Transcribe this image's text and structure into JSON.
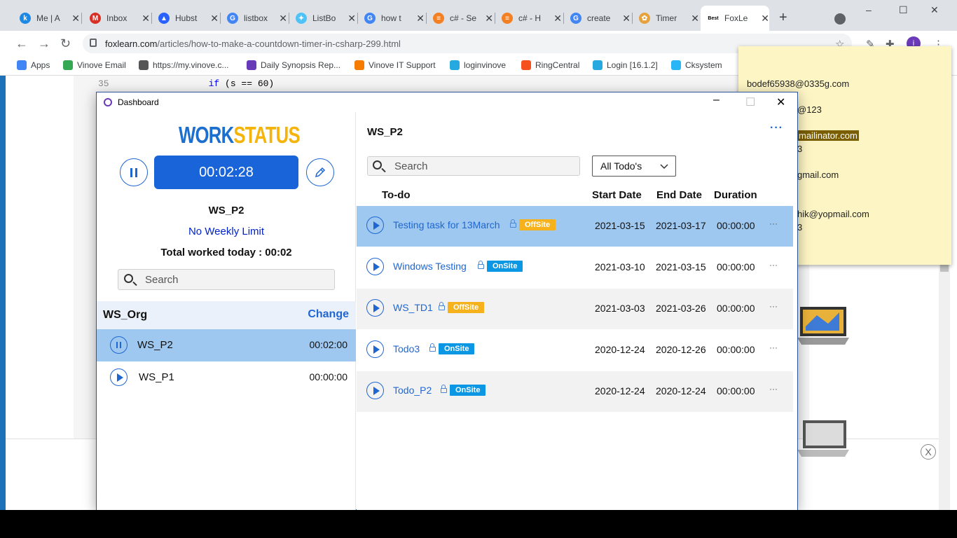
{
  "browser": {
    "tabs": [
      {
        "title": "Me | A",
        "color": "#1e88e5",
        "letter": "k"
      },
      {
        "title": "Inbox",
        "color": "#d93025",
        "letter": "M"
      },
      {
        "title": "Hubst",
        "color": "#2962ff",
        "letter": "▲"
      },
      {
        "title": "listbox",
        "color": "#4285f4",
        "letter": "G"
      },
      {
        "title": "ListBo",
        "color": "#4fc3f7",
        "letter": "✦"
      },
      {
        "title": "how t",
        "color": "#4285f4",
        "letter": "G"
      },
      {
        "title": "c# - Se",
        "color": "#f48024",
        "letter": "≡"
      },
      {
        "title": "c# - H",
        "color": "#f48024",
        "letter": "≡"
      },
      {
        "title": "create",
        "color": "#4285f4",
        "letter": "G"
      },
      {
        "title": "Timer",
        "color": "#e6a23c",
        "letter": "✿"
      },
      {
        "title": "FoxLe",
        "color": "#ffffff",
        "letter": "Best"
      }
    ],
    "new_tab": "+",
    "window_controls": [
      "–",
      "☐",
      "✕"
    ],
    "url": {
      "domain": "foxlearn.com",
      "path": "/articles/how-to-make-a-countdown-timer-in-csharp-299.html"
    },
    "profile_letter": "i",
    "bookmarks": [
      {
        "label": "Apps",
        "color": "#4285f4"
      },
      {
        "label": "Vinove Email",
        "color": "#34a853"
      },
      {
        "label": "https://my.vinove.c...",
        "color": "#555555"
      },
      {
        "label": "Daily Synopsis Rep...",
        "color": "#673ab7"
      },
      {
        "label": "Vinove IT Support",
        "color": "#f57c00"
      },
      {
        "label": "loginvinove",
        "color": "#26a9e0"
      },
      {
        "label": "RingCentral",
        "color": "#f4511e"
      },
      {
        "label": "Login [16.1.2]",
        "color": "#26a9e0"
      },
      {
        "label": "Cksystem",
        "color": "#29b6f6"
      }
    ]
  },
  "background_page": {
    "code_line_number": "35",
    "code_keyword": "if",
    "code_rest": " (s == 60)",
    "ad_close": "X"
  },
  "sticky_note": {
    "lines": [
      {
        "text": "bodef65938@0335g.com",
        "highlight": false
      },
      {
        "text": "@123",
        "highlight": false
      },
      {
        "text": "mailinator.com",
        "highlight": true
      },
      {
        "text": "3",
        "highlight": false
      },
      {
        "text": "gmail.com",
        "highlight": false
      },
      {
        "text": "hik@yopmail.com",
        "highlight": false
      },
      {
        "text": "3",
        "highlight": false
      }
    ]
  },
  "dashboard": {
    "window_title": "Dashboard",
    "logo": {
      "part1": "WORK",
      "part2": "STATUS"
    },
    "timer": "00:02:28",
    "project_name": "WS_P2",
    "weekly_limit": "No Weekly Limit",
    "total_today": "Total worked today : 00:02",
    "left_search_placeholder": "Search",
    "org_name": "WS_Org",
    "org_change": "Change",
    "projects": [
      {
        "name": "WS_P2",
        "time": "00:02:00",
        "selected": true,
        "state": "paused"
      },
      {
        "name": "WS_P1",
        "time": "00:00:00",
        "selected": false,
        "state": "play"
      }
    ],
    "right": {
      "title": "WS_P2",
      "more": "···",
      "search_placeholder": "Search",
      "filter": "All Todo's",
      "columns": {
        "todo": "To-do",
        "start": "Start Date",
        "end": "End Date",
        "duration": "Duration"
      },
      "todos": [
        {
          "name": "Testing task for 13March",
          "badge": "OffSite",
          "start": "2021-03-15",
          "end": "2021-03-17",
          "duration": "00:00:00",
          "row": "sel"
        },
        {
          "name": "Windows Testing",
          "badge": "OnSite",
          "start": "2021-03-10",
          "end": "2021-03-15",
          "duration": "00:00:00",
          "row": "plain"
        },
        {
          "name": "WS_TD1",
          "badge": "OffSite",
          "start": "2021-03-03",
          "end": "2021-03-26",
          "duration": "00:00:00",
          "row": "alt"
        },
        {
          "name": "Todo3",
          "badge": "OnSite",
          "start": "2020-12-24",
          "end": "2020-12-26",
          "duration": "00:00:00",
          "row": "plain"
        },
        {
          "name": "Todo_P2",
          "badge": "OnSite",
          "start": "2020-12-24",
          "end": "2020-12-24",
          "duration": "00:00:00",
          "row": "alt"
        }
      ],
      "row_more": "···"
    }
  },
  "colors": {
    "accent": "#1a64d9",
    "selected_row": "#9ec8ef",
    "offsite": "#f5b21d",
    "onsite": "#0c97e4",
    "sticky": "#fdf5c4"
  }
}
